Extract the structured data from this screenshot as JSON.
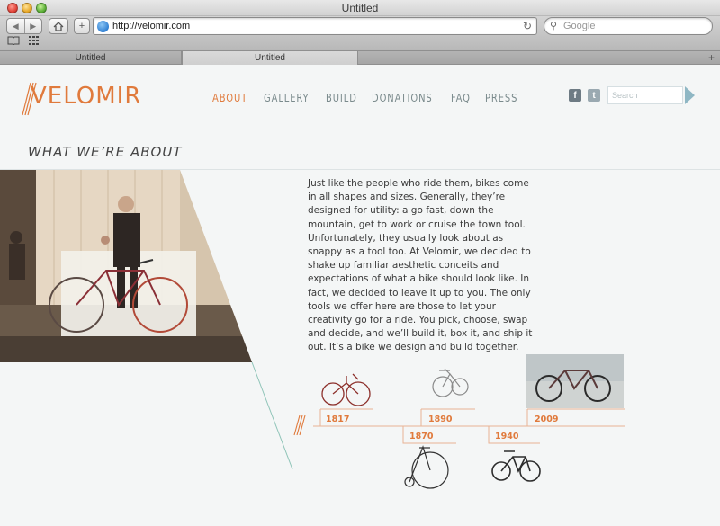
{
  "browser": {
    "window_title": "Untitled",
    "url": "http://velomir.com",
    "search_placeholder": "Google",
    "tabs": [
      {
        "label": "Untitled",
        "active": false
      },
      {
        "label": "Untitled",
        "active": true
      }
    ],
    "new_tab_label": "+"
  },
  "site": {
    "logo": "VELOMIR",
    "nav": [
      {
        "label": "ABOUT",
        "active": true
      },
      {
        "label": "GALLERY",
        "active": false
      },
      {
        "label": "BUILD",
        "active": false
      },
      {
        "label": "DONATIONS",
        "active": false
      },
      {
        "label": "FAQ",
        "active": false
      },
      {
        "label": "PRESS",
        "active": false
      }
    ],
    "search_placeholder": "Search",
    "section_title": "WHAT WE’RE ABOUT",
    "body_text": "Just like the people who ride them, bikes come in all shapes and sizes.  Generally, they’re designed for utility:  a go fast, down the mountain, get to work or cruise the town tool. Unfortunately, they usually look about as snappy as a tool too.  At Velomir, we decided to shake up familiar aesthetic conceits and expectations of what a bike should look like.  In fact, we decided to leave it up to you. The only tools we offer here are those to let your creativity go for a ride. You pick, choose, swap and decide, and we’ll build it, box it, and ship it out. It’s a bike we design and build together.",
    "timeline": [
      {
        "year": "1817",
        "position": "top"
      },
      {
        "year": "1870",
        "position": "bottom"
      },
      {
        "year": "1890",
        "position": "top"
      },
      {
        "year": "1940",
        "position": "bottom"
      },
      {
        "year": "2009",
        "position": "top"
      }
    ]
  },
  "colors": {
    "accent": "#e07a3c",
    "nav_text": "#7a8a8c",
    "background": "#f4f6f6",
    "timeline_line": "#e9b394",
    "diagonal": "#8fc4b8"
  }
}
